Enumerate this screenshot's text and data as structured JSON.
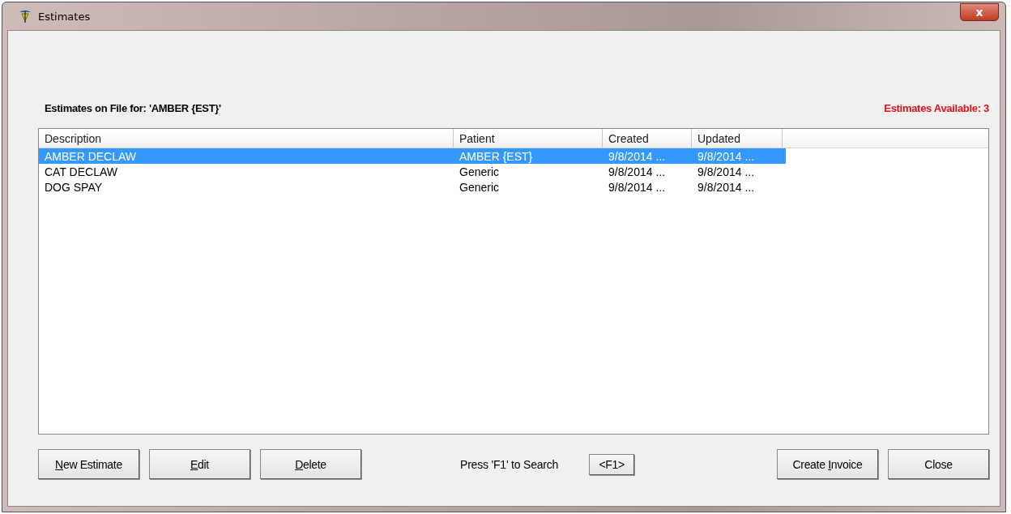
{
  "window": {
    "title": "Estimates",
    "close_glyph": "x"
  },
  "heading": "Estimates on File for: 'AMBER {EST}'",
  "available": "Estimates Available: 3",
  "table": {
    "columns": [
      "Description",
      "Patient",
      "Created",
      "Updated"
    ],
    "rows": [
      {
        "cells": [
          "AMBER DECLAW",
          "AMBER {EST}",
          "9/8/2014 ...",
          "9/8/2014 ..."
        ],
        "selected": true
      },
      {
        "cells": [
          "CAT DECLAW",
          "Generic",
          "9/8/2014 ...",
          "9/8/2014 ..."
        ],
        "selected": false
      },
      {
        "cells": [
          "DOG SPAY",
          "Generic",
          "9/8/2014 ...",
          "9/8/2014 ..."
        ],
        "selected": false
      }
    ]
  },
  "left_buttons": [
    {
      "key": "N",
      "post": "ew Estimate"
    },
    {
      "key": "E",
      "post": "dit"
    },
    {
      "key": "D",
      "post": "elete"
    }
  ],
  "search_hint": "Press 'F1' to Search",
  "search_button": "<F1>",
  "right_buttons": [
    {
      "pre": "Create ",
      "key": "I",
      "post": "nvoice"
    },
    {
      "pre": "Close"
    }
  ]
}
